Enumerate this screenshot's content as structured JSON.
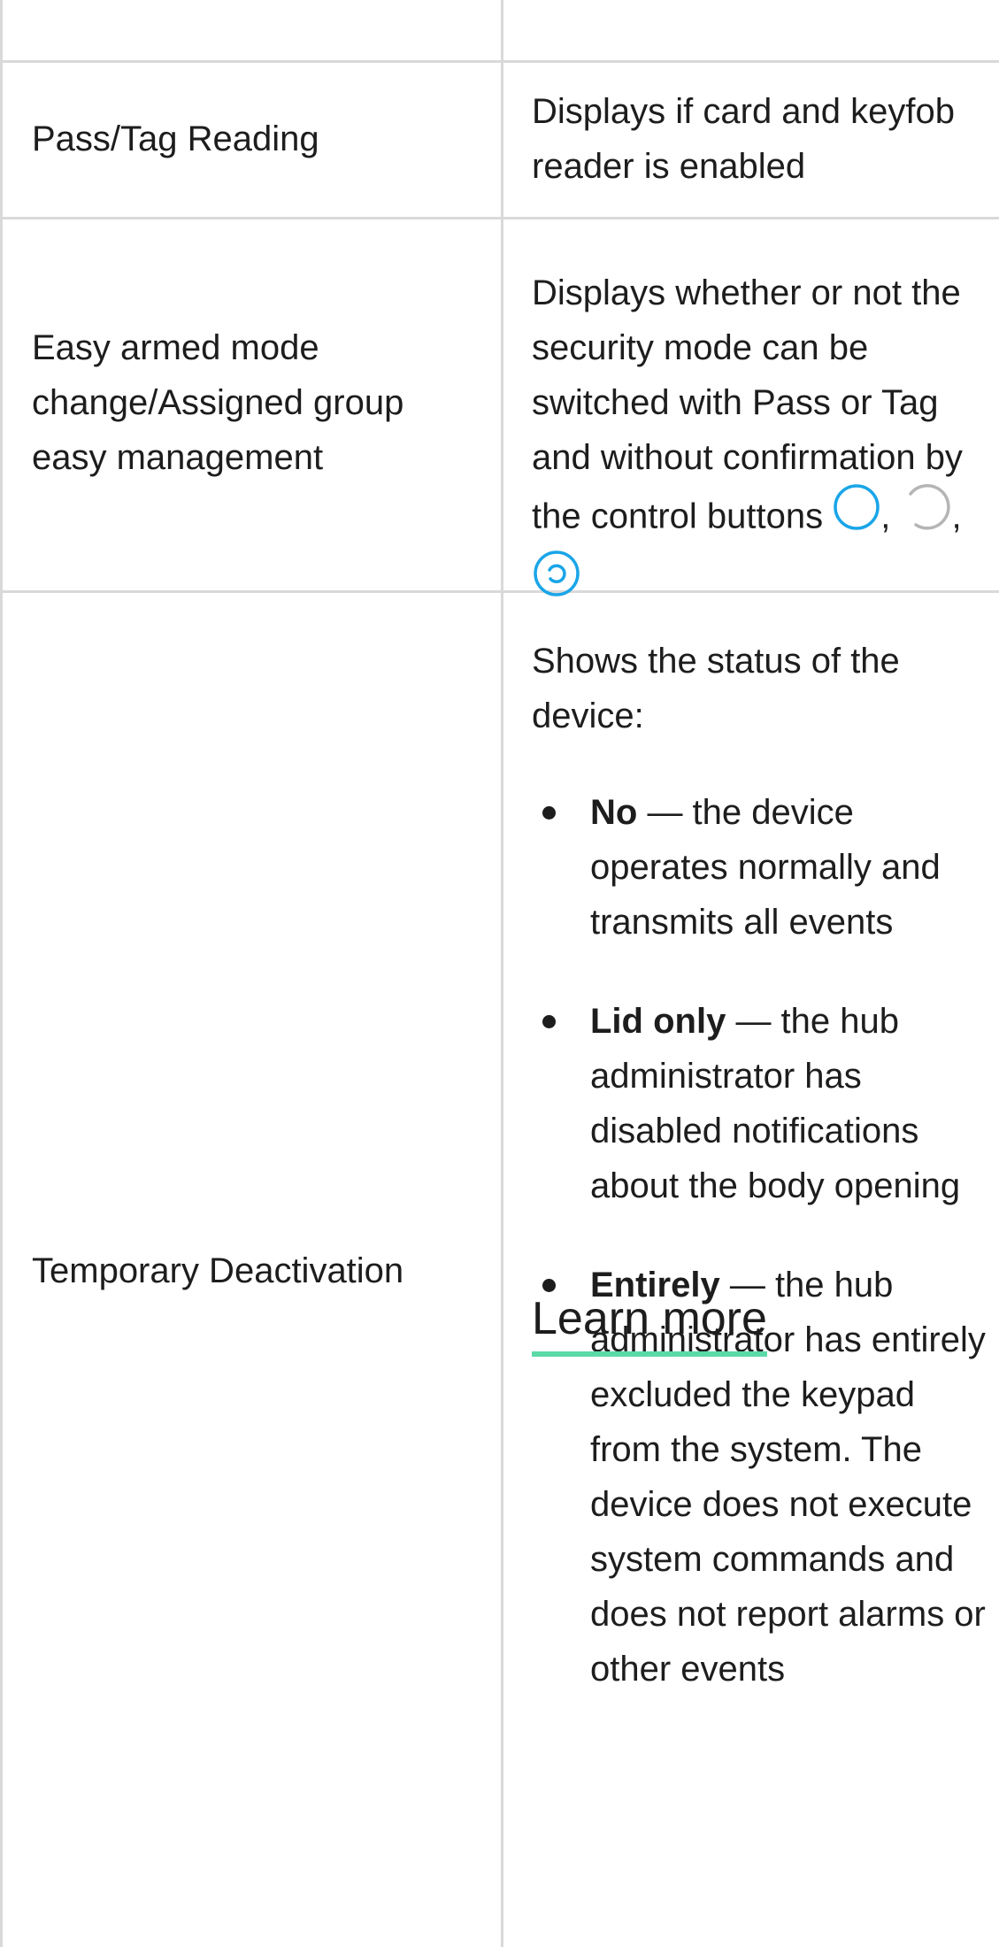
{
  "rows": [
    {
      "label": "",
      "description": ""
    },
    {
      "label": "Pass/Tag Reading",
      "description": "Displays if card and keyfob reader is enabled"
    },
    {
      "label": "Easy armed mode change/Assigned group easy management",
      "description_prefix": "Displays whether or not the security mode can be switched with Pass or Tag and without confirmation by the control buttons",
      "icons": [
        "arm-icon",
        "disarm-icon",
        "night-mode-icon"
      ],
      "icon_colors": [
        "#1aa5e8",
        "#b5b5b5",
        "#1aa5e8"
      ],
      "separator": ","
    },
    {
      "label": "Temporary Deactivation",
      "intro": "Shows the status of the device:",
      "items": [
        {
          "term": "No",
          "text": " — the device operates normally and transmits all events"
        },
        {
          "term": "Lid only",
          "text": " — the hub administrator has disabled notifications about the body opening"
        },
        {
          "term": "Entirely",
          "text": " — the hub administrator has entirely excluded the keypad from the system. The device does not execute system commands and does not report alarms or other events"
        }
      ],
      "link_text": "Learn more"
    }
  ],
  "colors": {
    "text": "#1d1d1d",
    "border": "#d9d9d9",
    "accent_blue": "#1aa5e8",
    "muted_gray": "#b5b5b5",
    "link_underline": "#5bd9a6"
  }
}
